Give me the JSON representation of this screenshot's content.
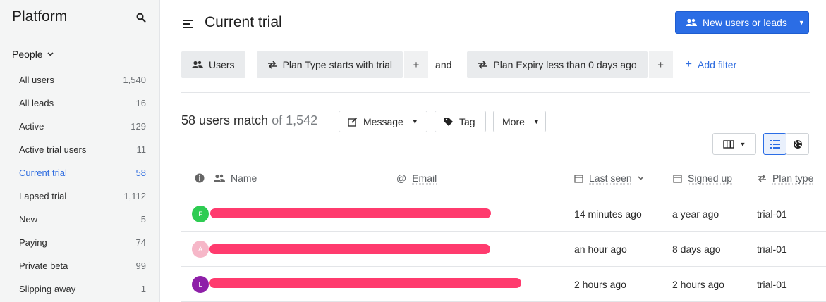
{
  "sidebar": {
    "title": "Platform",
    "section": "People",
    "items": [
      {
        "label": "All users",
        "count": "1,540"
      },
      {
        "label": "All leads",
        "count": "16"
      },
      {
        "label": "Active",
        "count": "129"
      },
      {
        "label": "Active trial users",
        "count": "11"
      },
      {
        "label": "Current trial",
        "count": "58"
      },
      {
        "label": "Lapsed trial",
        "count": "1,112"
      },
      {
        "label": "New",
        "count": "5"
      },
      {
        "label": "Paying",
        "count": "74"
      },
      {
        "label": "Private beta",
        "count": "99"
      },
      {
        "label": "Slipping away",
        "count": "1"
      }
    ]
  },
  "header": {
    "title": "Current trial",
    "new_button": "New users or leads"
  },
  "filters": {
    "users_chip": "Users",
    "f1_field": "Plan Type",
    "f1_rest": "starts with trial",
    "plus": "+",
    "and": "and",
    "f2_field": "Plan Expiry",
    "f2_rest": "less than 0 days ago",
    "add_filter": "Add filter"
  },
  "toolbar": {
    "match_count": "58 users match",
    "of_total": "of 1,542",
    "message": "Message",
    "tag": "Tag",
    "more": "More"
  },
  "table": {
    "columns": [
      "Name",
      "Email",
      "Last seen",
      "Signed up",
      "Plan type"
    ],
    "rows": [
      {
        "initial": "F",
        "avatar_color": "#2ecc52",
        "last_seen": "14 minutes ago",
        "signed_up": "a year ago",
        "plan_type": "trial-01"
      },
      {
        "initial": "A",
        "avatar_color": "#f6b7c8",
        "last_seen": "an hour ago",
        "signed_up": "8 days ago",
        "plan_type": "trial-01"
      },
      {
        "initial": "L",
        "avatar_color": "#8e1fa8",
        "last_seen": "2 hours ago",
        "signed_up": "2 hours ago",
        "plan_type": "trial-01"
      }
    ]
  },
  "colors": {
    "accent": "#2b6de5",
    "redaction": "#ff3b6e"
  }
}
